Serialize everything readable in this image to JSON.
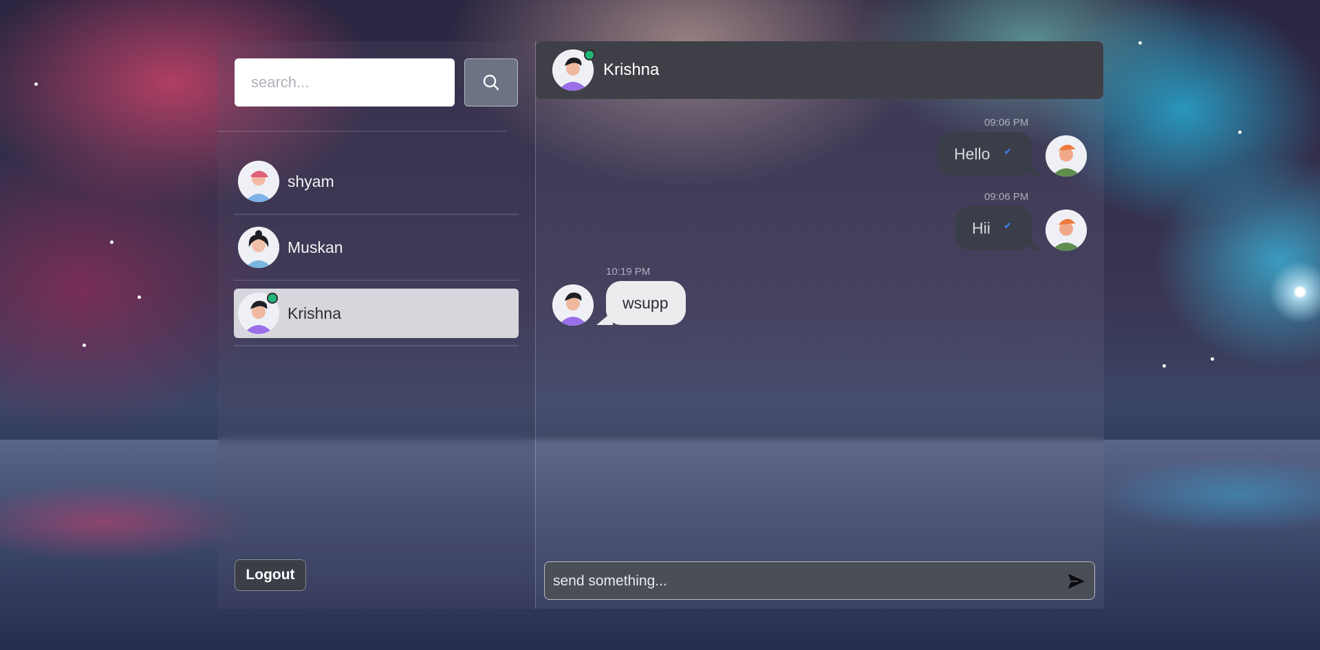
{
  "search": {
    "placeholder": "search..."
  },
  "contacts": [
    {
      "name": "shyam",
      "online": false,
      "active": false
    },
    {
      "name": "Muskan",
      "online": false,
      "active": false
    },
    {
      "name": "Krishna",
      "online": true,
      "active": true
    }
  ],
  "logout_label": "Logout",
  "chat": {
    "header_name": "Krishna",
    "messages": [
      {
        "direction": "out",
        "time": "09:06 PM",
        "text": "Hello",
        "status": "sent"
      },
      {
        "direction": "out",
        "time": "09:06 PM",
        "text": "Hii",
        "status": "sent"
      },
      {
        "direction": "in",
        "time": "10:19 PM",
        "text": "wsupp"
      }
    ],
    "composer_placeholder": "send something..."
  },
  "colors": {
    "active_contact_bg": "#d6d6dc",
    "online_indicator": "#23b877",
    "check_mark": "#3b82f6",
    "header_bg": "#3f4047"
  },
  "icons": {
    "search": "search-icon",
    "send": "send-icon",
    "check": "check-icon"
  }
}
